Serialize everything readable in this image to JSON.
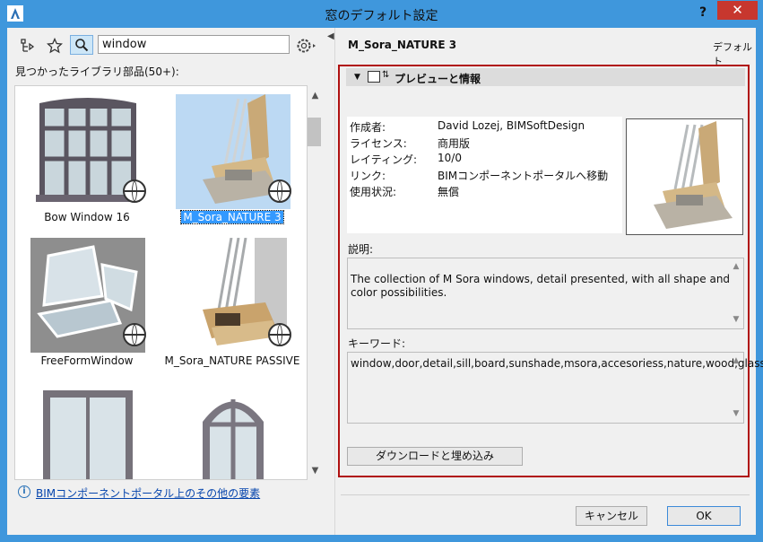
{
  "window": {
    "title": "窓のデフォルト設定",
    "help": "?",
    "close": "✕"
  },
  "left": {
    "search_value": "window",
    "found_label": "見つかったライブラリ部品(50+):",
    "items": [
      {
        "name": "Bow Window 16",
        "selected": false
      },
      {
        "name": "M_Sora_NATURE 3",
        "selected": true
      },
      {
        "name": "FreeFormWindow",
        "selected": false
      },
      {
        "name": "M_Sora_NATURE PASSIVE",
        "selected": false
      },
      {
        "name": "",
        "selected": false
      },
      {
        "name": "",
        "selected": false
      }
    ],
    "footer_link": "BIMコンポーネントポータル上のその他の要素",
    "icons": [
      "tree-navigator-icon",
      "star-icon",
      "search-icon",
      "gear-icon",
      "info-icon"
    ]
  },
  "right": {
    "item_name": "M_Sora_NATURE 3",
    "default_label": "デフォルト",
    "section_title": "プレビューと情報",
    "meta": [
      {
        "label": "作成者:",
        "value": "David Lozej, BIMSoftDesign"
      },
      {
        "label": "ライセンス:",
        "value": "商用版"
      },
      {
        "label": "レイティング:",
        "value": "10/0"
      },
      {
        "label": "リンク:",
        "value": "BIMコンポーネントポータルへ移動"
      },
      {
        "label": "使用状況:",
        "value": "無償"
      }
    ],
    "description_label": "説明:",
    "description": "The collection of M Sora windows, detail presented, with all shape and color possibilities.",
    "keywords_label": "キーワード:",
    "keywords": "window,door,detail,sill,board,sunshade,msora,accesoriess,nature,wood,glass",
    "download_button": "ダウンロードと埋め込み"
  },
  "footer": {
    "cancel": "キャンセル",
    "ok": "OK"
  },
  "colors": {
    "titlebar": "#3f97dc",
    "close": "#c7372e",
    "highlight_frame": "#b01010",
    "selection": "#3399ff"
  }
}
